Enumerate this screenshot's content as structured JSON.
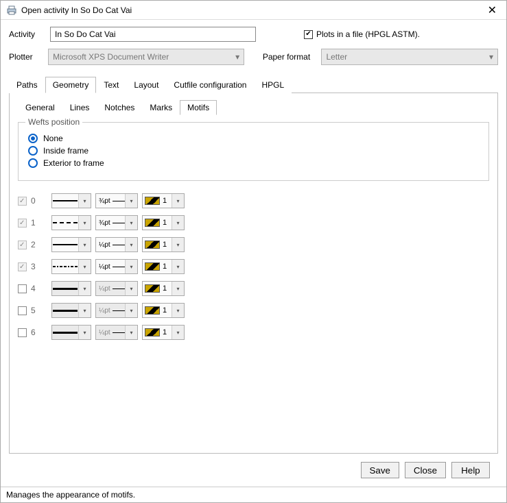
{
  "window": {
    "title": "Open activity In So Do Cat Vai"
  },
  "form": {
    "activity_label": "Activity",
    "activity_value": "In So Do Cat Vai",
    "plots_checkbox_label": "Plots in a file (HPGL ASTM).",
    "plots_checked": true,
    "plotter_label": "Plotter",
    "plotter_value": "Microsoft XPS Document Writer",
    "paper_label": "Paper format",
    "paper_value": "Letter"
  },
  "tabs": {
    "outer": [
      "Paths",
      "Geometry",
      "Text",
      "Layout",
      "Cutfile configuration",
      "HPGL"
    ],
    "outer_active": 1,
    "inner": [
      "General",
      "Lines",
      "Notches",
      "Marks",
      "Motifs"
    ],
    "inner_active": 4
  },
  "wefts": {
    "legend": "Wefts position",
    "options": [
      "None",
      "Inside frame",
      "Exterior to frame"
    ],
    "selected": 0
  },
  "motifs": [
    {
      "idx": "0",
      "checked": true,
      "enabled_chk": false,
      "style": "solid",
      "weight": "¾pt",
      "color_num": "1",
      "row_disabled": false
    },
    {
      "idx": "1",
      "checked": true,
      "enabled_chk": false,
      "style": "dashed",
      "weight": "¾pt",
      "color_num": "1",
      "row_disabled": false
    },
    {
      "idx": "2",
      "checked": true,
      "enabled_chk": false,
      "style": "solid",
      "weight": "¼pt",
      "color_num": "1",
      "row_disabled": false
    },
    {
      "idx": "3",
      "checked": true,
      "enabled_chk": false,
      "style": "dotdash",
      "weight": "¼pt",
      "color_num": "1",
      "row_disabled": false
    },
    {
      "idx": "4",
      "checked": false,
      "enabled_chk": true,
      "style": "thick",
      "weight": "¼pt",
      "color_num": "1",
      "row_disabled": true
    },
    {
      "idx": "5",
      "checked": false,
      "enabled_chk": true,
      "style": "thick",
      "weight": "¼pt",
      "color_num": "1",
      "row_disabled": true
    },
    {
      "idx": "6",
      "checked": false,
      "enabled_chk": true,
      "style": "thick",
      "weight": "¼pt",
      "color_num": "1",
      "row_disabled": true
    }
  ],
  "buttons": {
    "save": "Save",
    "close": "Close",
    "help": "Help"
  },
  "status": "Manages the appearance of motifs."
}
